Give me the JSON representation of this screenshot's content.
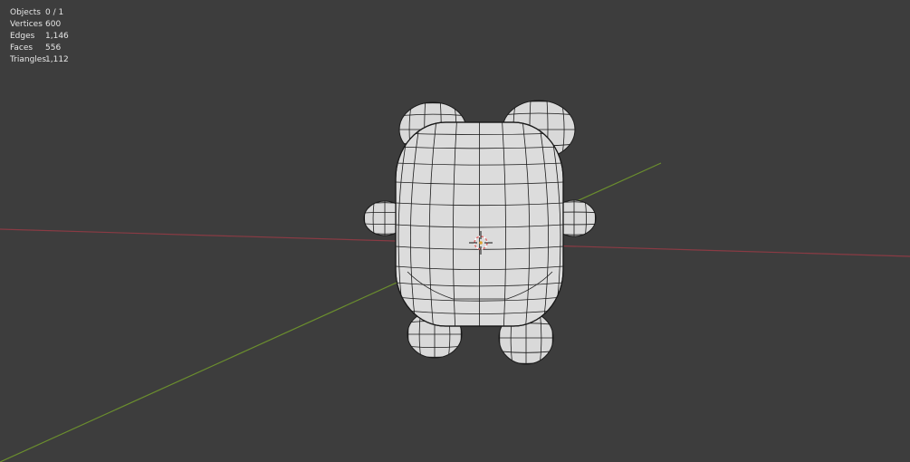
{
  "viewport": {
    "background": "#3d3d3d",
    "x_axis_color": "#8a3b44",
    "y_axis_color": "#6b8e2e"
  },
  "statistics": [
    {
      "label": "Objects",
      "value": "0 / 1"
    },
    {
      "label": "Vertices",
      "value": "600"
    },
    {
      "label": "Edges",
      "value": "1,146"
    },
    {
      "label": "Faces",
      "value": "556"
    },
    {
      "label": "Triangles",
      "value": "1,112"
    }
  ],
  "model": {
    "surface_color": "#d9d9d9",
    "wire_color": "#1a1a1a"
  },
  "cursor": {
    "icon": "3d-cursor-icon",
    "ring_color": "#e07070"
  }
}
